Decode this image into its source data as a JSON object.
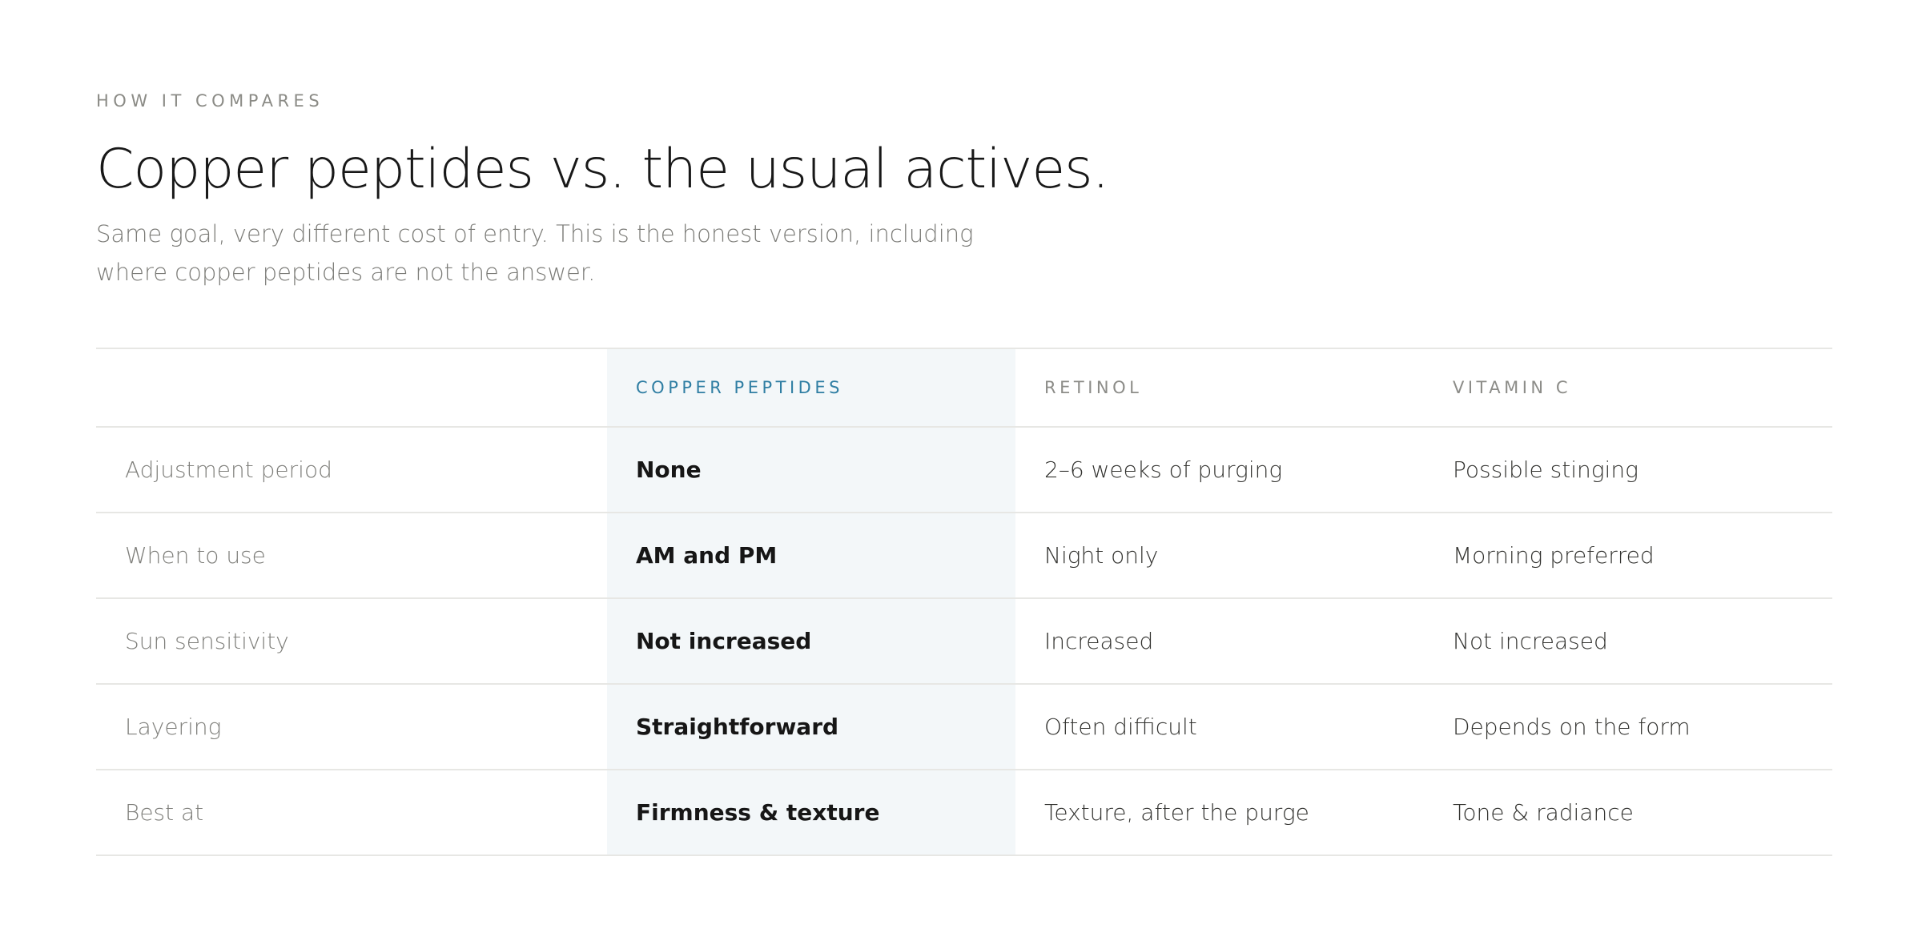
{
  "section": {
    "eyebrow": "HOW IT COMPARES",
    "title": "Copper peptides vs. the usual actives.",
    "subtitle": "Same goal, very different cost of entry. This is the honest version, including where copper peptides are not the answer."
  },
  "table": {
    "headers": [
      "",
      "COPPER PEPTIDES",
      "RETINOL",
      "VITAMIN C"
    ],
    "rows": [
      {
        "label": "Adjustment period",
        "copper": "None",
        "retinol": "2–6 weeks of purging",
        "vitamin_c": "Possible stinging"
      },
      {
        "label": "When to use",
        "copper": "AM and PM",
        "retinol": "Night only",
        "vitamin_c": "Morning preferred"
      },
      {
        "label": "Sun sensitivity",
        "copper": "Not increased",
        "retinol": "Increased",
        "vitamin_c": "Not increased"
      },
      {
        "label": "Layering",
        "copper": "Straightforward",
        "retinol": "Often difficult",
        "vitamin_c": "Depends on the form"
      },
      {
        "label": "Best at",
        "copper": "Firmness & texture",
        "retinol": "Texture, after the purge",
        "vitamin_c": "Tone & radiance"
      }
    ]
  },
  "colors": {
    "accent": "#2f7ea3",
    "highlight_bg": "#f3f7f9",
    "divider": "#e7e7e4",
    "muted_text": "#7f7f7b"
  }
}
